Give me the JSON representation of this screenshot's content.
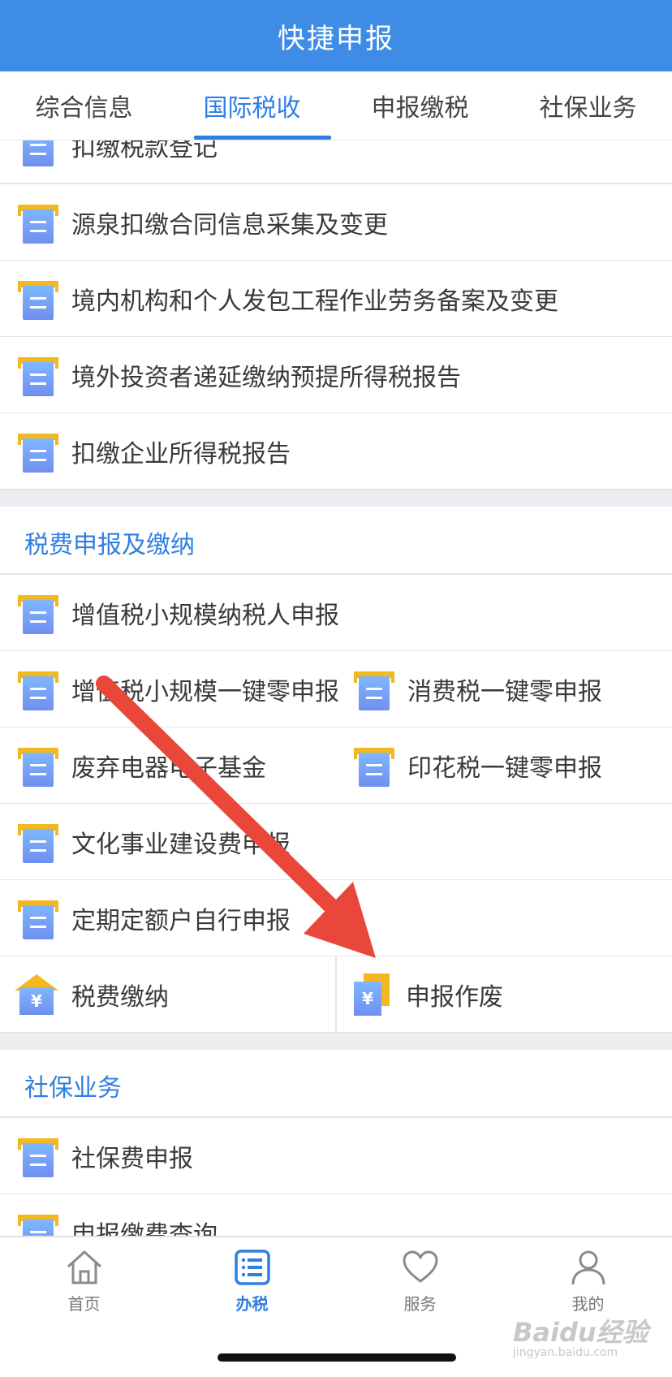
{
  "header": {
    "title": "快捷申报"
  },
  "tabs": [
    {
      "label": "综合信息",
      "active": false
    },
    {
      "label": "国际税收",
      "active": true
    },
    {
      "label": "申报缴税",
      "active": false
    },
    {
      "label": "社保业务",
      "active": false
    }
  ],
  "intl_items": [
    "扣缴税款登记",
    "源泉扣缴合同信息采集及变更",
    "境内机构和个人发包工程作业劳务备案及变更",
    "境外投资者递延缴纳预提所得税报告",
    "扣缴企业所得税报告"
  ],
  "tax_section": {
    "title": "税费申报及缴纳",
    "items": {
      "vat_small": "增值税小规模纳税人申报",
      "vat_zero": "增值税小规模一键零申报",
      "consumption_zero": "消费税一键零申报",
      "waste_fund": "废弃电器电子基金",
      "stamp_zero": "印花税一键零申报",
      "culture_fee": "文化事业建设费申报",
      "fixed_quota": "定期定额户自行申报",
      "tax_payment": "税费缴纳",
      "void_declaration": "申报作废"
    }
  },
  "social_section": {
    "title": "社保业务",
    "items": [
      "社保费申报",
      "申报缴费查询"
    ]
  },
  "bottom_nav": [
    {
      "label": "首页",
      "icon": "home-icon",
      "active": false
    },
    {
      "label": "办税",
      "icon": "tax-list-icon",
      "active": true
    },
    {
      "label": "服务",
      "icon": "heart-icon",
      "active": false
    },
    {
      "label": "我的",
      "icon": "user-icon",
      "active": false
    }
  ],
  "watermark": {
    "brand": "Baidu经验",
    "url": "jingyan.baidu.com"
  },
  "colors": {
    "header": "#3f8ce6",
    "accent": "#2f7fe0",
    "arrow": "#e8473a",
    "icon_top": "#f3b71f",
    "icon_body": "#6f8ff0"
  }
}
